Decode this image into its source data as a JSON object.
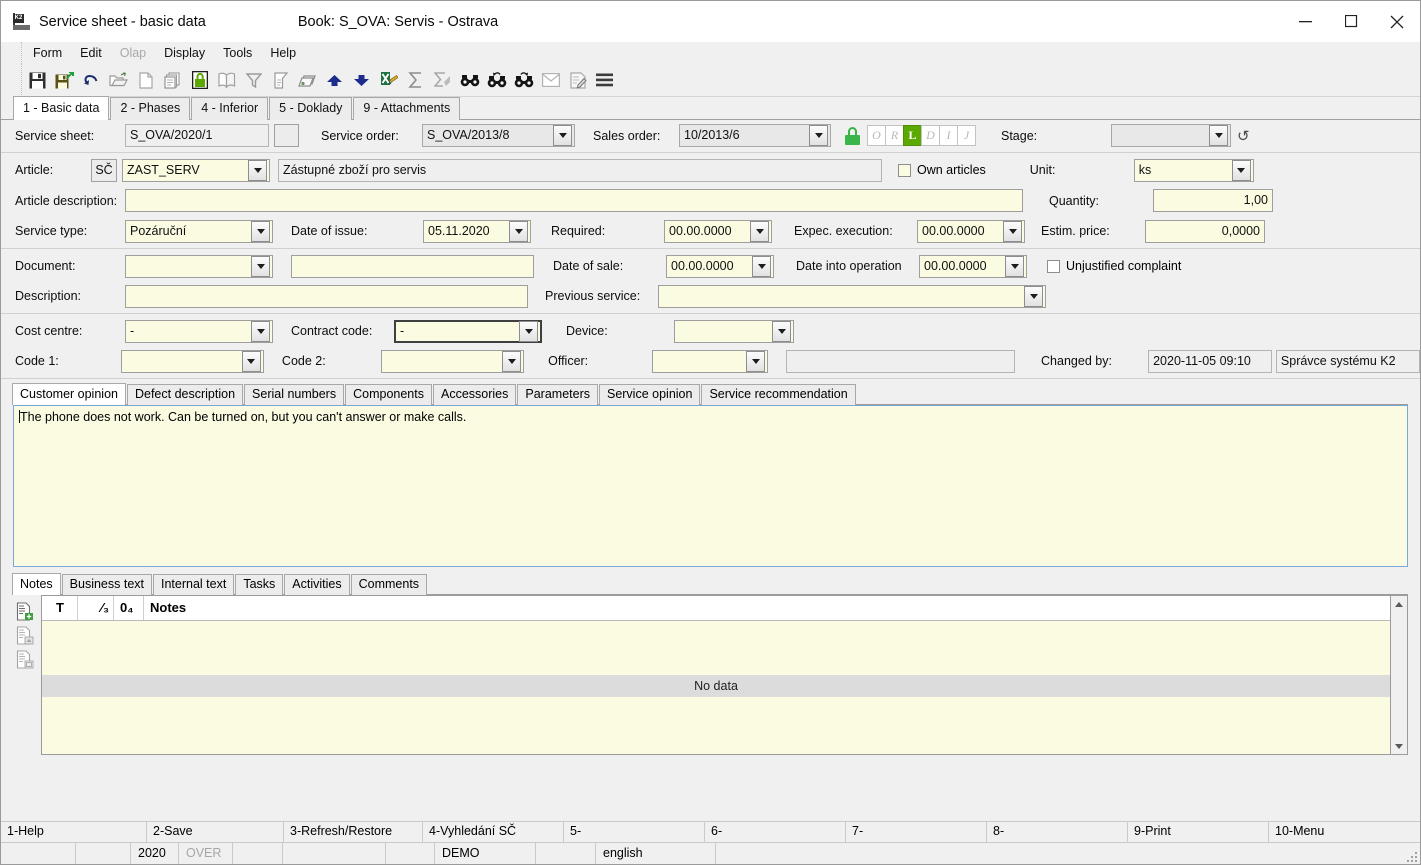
{
  "window": {
    "title": "Service sheet - basic data",
    "book": "Book: S_OVA: Servis - Ostrava",
    "app_icon": "k2-app-icon",
    "minimize": "─",
    "maximize": "☐",
    "close": "✕"
  },
  "menu": [
    {
      "label": "Form",
      "disabled": false
    },
    {
      "label": "Edit",
      "disabled": false
    },
    {
      "label": "Olap",
      "disabled": true
    },
    {
      "label": "Display",
      "disabled": false
    },
    {
      "label": "Tools",
      "disabled": false
    },
    {
      "label": "Help",
      "disabled": false
    }
  ],
  "toolbar": [
    {
      "name": "save-icon"
    },
    {
      "name": "save-and-exit-icon"
    },
    {
      "name": "undo-icon"
    },
    {
      "name": "open-folder-icon"
    },
    {
      "name": "new-document-icon"
    },
    {
      "name": "copy-icon"
    },
    {
      "name": "lock-icon"
    },
    {
      "name": "book-icon"
    },
    {
      "name": "filter-icon"
    },
    {
      "name": "document-filter-icon"
    },
    {
      "name": "print-icon"
    },
    {
      "name": "arrow-up-icon"
    },
    {
      "name": "arrow-down-icon"
    },
    {
      "name": "excel-export-icon"
    },
    {
      "name": "sum-icon"
    },
    {
      "name": "sum-filter-icon"
    },
    {
      "name": "find-icon"
    },
    {
      "name": "find-previous-icon"
    },
    {
      "name": "find-next-icon"
    },
    {
      "name": "mail-icon"
    },
    {
      "name": "note-edit-icon"
    },
    {
      "name": "menu-hamburger-icon"
    }
  ],
  "tabs": [
    {
      "label": "1 - Basic data",
      "active": true
    },
    {
      "label": "2 - Phases",
      "active": false
    },
    {
      "label": "4 - Inferior",
      "active": false
    },
    {
      "label": "5 - Doklady",
      "active": false
    },
    {
      "label": "9 - Attachments",
      "active": false
    }
  ],
  "form": {
    "service_sheet_label": "Service sheet:",
    "service_sheet_value": "S_OVA/2020/1",
    "service_order_label": "Service order:",
    "service_order_value": "S_OVA/2013/8",
    "sales_order_label": "Sales order:",
    "sales_order_value": "10/2013/6",
    "status_badges": [
      {
        "letter": "O",
        "active": false
      },
      {
        "letter": "R",
        "active": false
      },
      {
        "letter": "L",
        "active": true
      },
      {
        "letter": "D",
        "active": false
      },
      {
        "letter": "I",
        "active": false
      },
      {
        "letter": "J",
        "active": false
      }
    ],
    "stage_label": "Stage:",
    "stage_value": "",
    "article_label": "Article:",
    "article_button": "SČ",
    "article_value": "ZAST_SERV",
    "article_name": "Zástupné zboží pro servis",
    "own_articles_label": "Own articles",
    "own_articles_checked": false,
    "unit_label": "Unit:",
    "unit_value": "ks",
    "article_description_label": "Article description:",
    "article_description_value": "",
    "quantity_label": "Quantity:",
    "quantity_value": "1,00",
    "service_type_label": "Service type:",
    "service_type_value": "Pozáruční",
    "date_of_issue_label": "Date of issue:",
    "date_of_issue_value": "05.11.2020",
    "required_label": "Required:",
    "required_value": "00.00.0000",
    "expec_execution_label": "Expec. execution:",
    "expec_execution_value": "00.00.0000",
    "estim_price_label": "Estim. price:",
    "estim_price_value": "0,0000",
    "document_label": "Document:",
    "document_value": "",
    "document_text_value": "",
    "date_of_sale_label": "Date of sale:",
    "date_of_sale_value": "00.00.0000",
    "date_into_operation_label": "Date into operation",
    "date_into_operation_value": "00.00.0000",
    "unjustified_complaint_label": "Unjustified complaint",
    "unjustified_complaint_checked": false,
    "description_label": "Description:",
    "description_value": "",
    "previous_service_label": "Previous service:",
    "previous_service_value": "",
    "cost_centre_label": "Cost centre:",
    "cost_centre_value": "-",
    "contract_code_label": "Contract code:",
    "contract_code_value": "-",
    "device_label": "Device:",
    "device_value": "",
    "code1_label": "Code 1:",
    "code1_value": "",
    "code2_label": "Code 2:",
    "code2_value": "",
    "officer_label": "Officer:",
    "officer_value": "",
    "officer_name_value": "",
    "changed_by_label": "Changed by:",
    "changed_by_date": "2020-11-05 09:10",
    "changed_by_user": "Správce systému K2"
  },
  "text_tabs": [
    {
      "label": "Customer opinion",
      "active": true
    },
    {
      "label": "Defect description",
      "active": false
    },
    {
      "label": "Serial numbers",
      "active": false
    },
    {
      "label": "Components",
      "active": false
    },
    {
      "label": "Accessories",
      "active": false
    },
    {
      "label": "Parameters",
      "active": false
    },
    {
      "label": "Service opinion",
      "active": false
    },
    {
      "label": "Service recommendation",
      "active": false
    }
  ],
  "memo": {
    "text": "The phone does not work. Can be turned on, but you can't answer or make calls."
  },
  "notes_tabs": [
    {
      "label": "Notes",
      "active": true
    },
    {
      "label": "Business text",
      "active": false
    },
    {
      "label": "Internal text",
      "active": false
    },
    {
      "label": "Tasks",
      "active": false
    },
    {
      "label": "Activities",
      "active": false
    },
    {
      "label": "Comments",
      "active": false
    }
  ],
  "notes_tools": [
    {
      "name": "add-note-icon"
    },
    {
      "name": "edit-note-icon"
    },
    {
      "name": "copy-note-icon"
    }
  ],
  "notes_grid": {
    "columns": [
      "T",
      "⁄₃",
      "0₄",
      "Notes"
    ],
    "empty_message": "No data",
    "rows": []
  },
  "function_keys": [
    "1-Help",
    "2-Save",
    "3-Refresh/Restore",
    "4-Vyhledání SČ",
    "5-",
    "6-",
    "7-",
    "8-",
    "9-Print",
    "10-Menu"
  ],
  "status_bar": [
    {
      "text": "",
      "dim": false
    },
    {
      "text": "",
      "dim": false
    },
    {
      "text": "2020",
      "dim": false
    },
    {
      "text": "OVER",
      "dim": true
    },
    {
      "text": "",
      "dim": false
    },
    {
      "text": "",
      "dim": false
    },
    {
      "text": "",
      "dim": false
    },
    {
      "text": "DEMO",
      "dim": false
    },
    {
      "text": "",
      "dim": false
    },
    {
      "text": "english",
      "dim": false
    },
    {
      "text": "",
      "dim": false
    }
  ],
  "colors": {
    "field_cream": "#fbfbe2",
    "field_grey": "#e8e8e8",
    "accent_green": "#5aa800",
    "window_bg": "#f0f0f0",
    "memo_border": "#7ba7d7"
  }
}
